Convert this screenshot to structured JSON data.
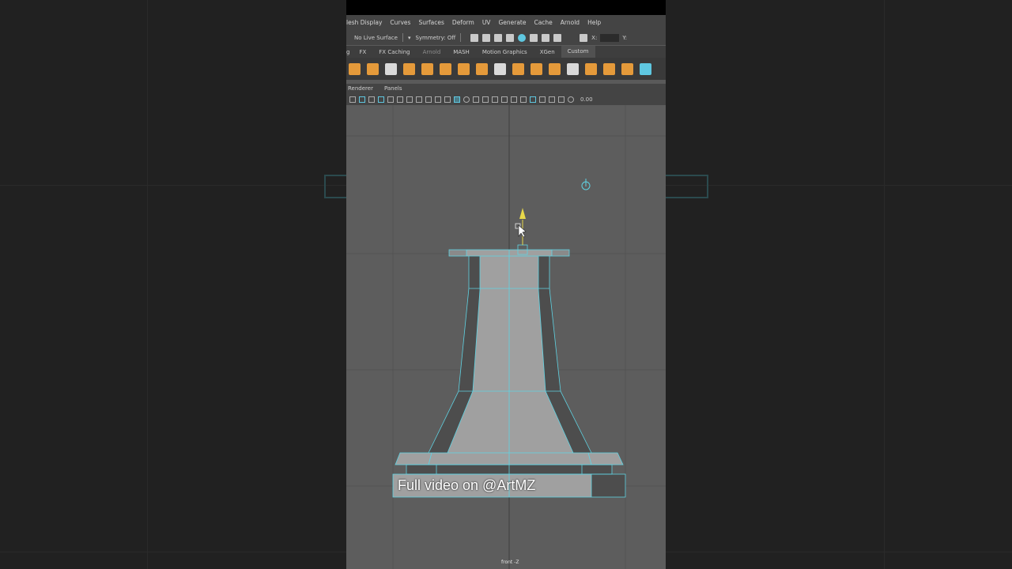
{
  "menu": {
    "items": [
      "lesh Display",
      "Curves",
      "Surfaces",
      "Deform",
      "UV",
      "Generate",
      "Cache",
      "Arnold",
      "Help"
    ]
  },
  "status": {
    "live_surface": "No Live Surface",
    "symmetry": "Symmetry: Off",
    "x_label": "X:",
    "y_label": "Y:"
  },
  "shelf_tabs": [
    {
      "label": "g",
      "state": "normal"
    },
    {
      "label": "FX",
      "state": "normal"
    },
    {
      "label": "FX Caching",
      "state": "normal"
    },
    {
      "label": "Arnold",
      "state": "muted"
    },
    {
      "label": "MASH",
      "state": "normal"
    },
    {
      "label": "Motion Graphics",
      "state": "normal"
    },
    {
      "label": "XGen",
      "state": "normal"
    },
    {
      "label": "Custom",
      "state": "active"
    }
  ],
  "panel_menu": {
    "renderer": "Renderer",
    "panels": "Panels"
  },
  "view_toolbar": {
    "value": "0.00"
  },
  "viewport": {
    "camera_label": "front -Z",
    "wire_color": "#5fd3e3",
    "mesh_fill": "#a0a0a0",
    "mesh_shadow": "#4d4d4d",
    "manipulator_color": "#e8d84a"
  },
  "overlay": {
    "caption": "Full video on @ArtMZ"
  },
  "colors": {
    "shelf_icon": "#e59a3a",
    "shelf_icon_alt": "#d9d9d9",
    "active_icon": "#5fc7e0"
  }
}
